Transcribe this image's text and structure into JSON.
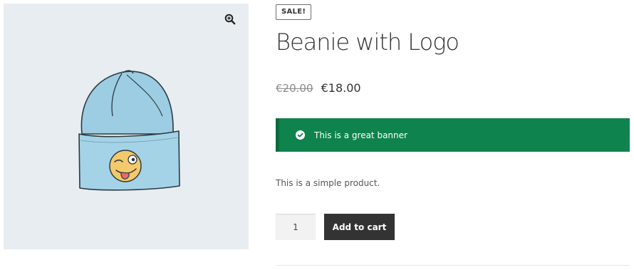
{
  "product": {
    "sale_badge": "SALE!",
    "title": "Beanie with Logo",
    "regular_price": "€20.00",
    "sale_price": "€18.00",
    "description": "This is a simple product."
  },
  "banner": {
    "text": "This is a great banner",
    "background_color": "#0f834d"
  },
  "cart": {
    "quantity": "1",
    "add_to_cart_label": "Add to cart"
  },
  "gallery": {
    "zoom_icon": "zoom-in-icon",
    "image": "beanie-image",
    "background_color": "#e8edf1"
  }
}
